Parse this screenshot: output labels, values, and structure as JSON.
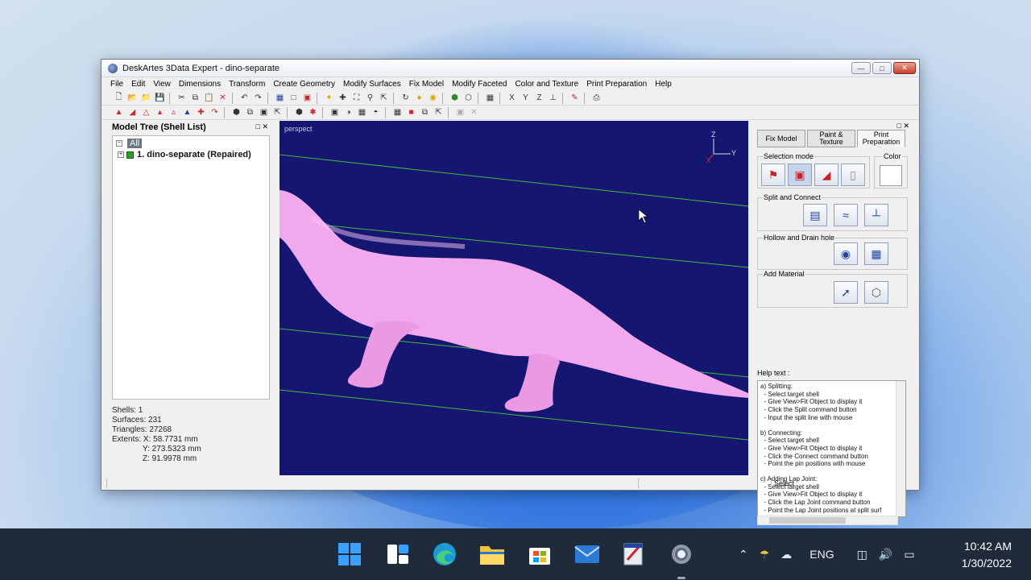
{
  "window": {
    "title": "DeskArtes 3Data Expert - dino-separate"
  },
  "menu": [
    "File",
    "Edit",
    "View",
    "Dimensions",
    "Transform",
    "Create Geometry",
    "Modify Surfaces",
    "Fix Model",
    "Modify Faceted",
    "Color and Texture",
    "Print Preparation",
    "Help"
  ],
  "model_tree": {
    "title": "Model Tree (Shell List)",
    "root": "All",
    "item": "1. dino-separate (Repaired)"
  },
  "stats": {
    "shells": "Shells: 1",
    "surfaces": "Surfaces: 231",
    "triangles": "Triangles: 27268",
    "extents_x": "Extents:  X: 58.7731 mm",
    "extents_y": "Y: 273.5323 mm",
    "extents_z": "Z: 91.9978 mm"
  },
  "viewport": {
    "label": "perspect",
    "axis_z": "Z",
    "axis_y": "Y",
    "axis_x": "X",
    "background": "#141672",
    "model_color": "#f2a8ec"
  },
  "right_panel": {
    "tabs": [
      "Fix Model",
      "Paint & Texture",
      "Print Preparation"
    ],
    "selection_mode": "Selection mode",
    "color": "Color",
    "split_connect": "Split and Connect",
    "hollow": "Hollow and Drain hole",
    "add_material": "Add Material",
    "help_label": "Help text :",
    "help_lines": [
      "a) Splitting:",
      "  - Select target shell",
      "  - Give View>Fit Object to display it",
      "  - Click the Split command button",
      "  - Input the split line with mouse",
      "b) Connecting:",
      "  - Select target shell",
      "  - Give View>Fit Object to display it",
      "  - Click the Connect command button",
      "  - Point the pin positions with mouse",
      "c) Adding Lap Joint:",
      "  - Select target shell",
      "  - Give View>Fit Object to display it",
      "  - Click the Lap Joint command button",
      "  - Point the Lap Joint positions at split surf"
    ]
  },
  "statusbar": {
    "mode": "Select"
  },
  "taskbar": {
    "lang": "ENG",
    "time": "10:42 AM",
    "date": "1/30/2022"
  }
}
